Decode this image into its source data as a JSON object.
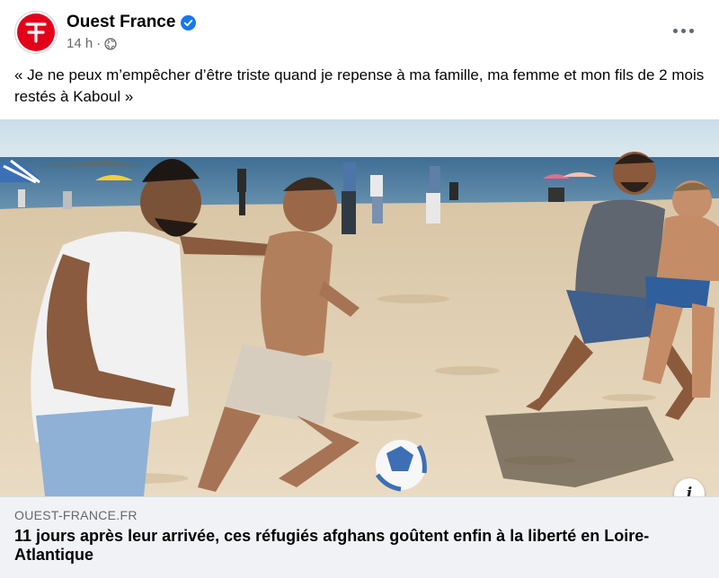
{
  "post": {
    "page_name": "Ouest France",
    "timestamp": "14 h",
    "separator": "·",
    "verified_icon": "verified-badge-icon",
    "audience_icon": "globe-icon",
    "more_icon": "more-options-icon",
    "caption": "« Je ne peux m’empêcher d’être triste quand je repense à ma famille, ma femme et mon fils de 2 mois restés à Kaboul »"
  },
  "link_preview": {
    "domain": "OUEST-FRANCE.FR",
    "headline": "11 jours après leur arrivée, ces réfugiés afghans goûtent enfin à la liberté en Loire-Atlantique",
    "info_label": "i"
  },
  "colors": {
    "brand_red": "#e2001a",
    "verified_blue": "#1877f2",
    "meta_gray": "#65676b",
    "link_bg": "#f0f2f5"
  }
}
